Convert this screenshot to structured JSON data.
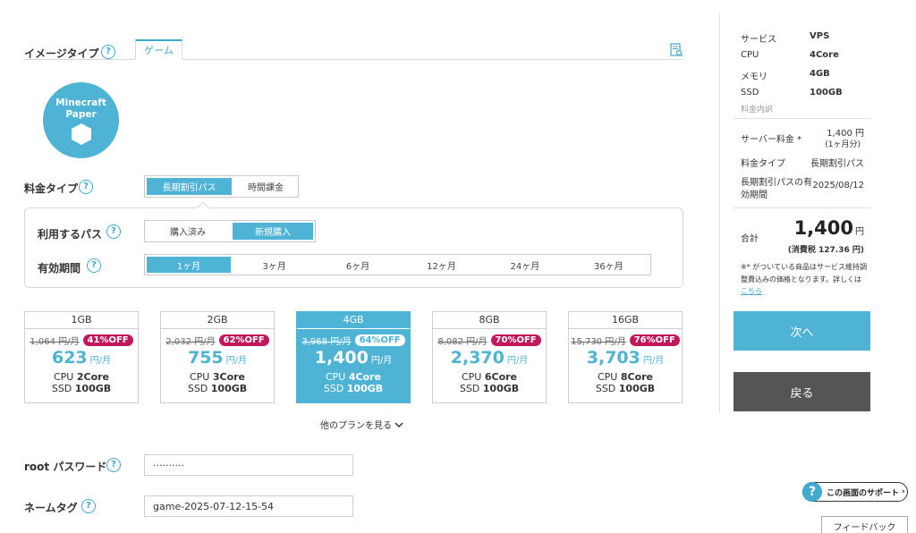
{
  "image_type": {
    "label": "イメージタイプ",
    "help": "?",
    "tab": "ゲーム",
    "doc_icon": "document-search-icon"
  },
  "logo": {
    "line1": "Minecraft",
    "line2": "Paper",
    "icon": "cube-icon"
  },
  "pricing_type": {
    "label": "料金タイプ",
    "help": "?",
    "options": [
      "長期割引パス",
      "時間課金"
    ],
    "selected": "長期割引パス"
  },
  "pass": {
    "label": "利用するパス",
    "help": "?",
    "options": [
      "購入済み",
      "新規購入"
    ],
    "selected": "新規購入"
  },
  "period": {
    "label": "有効期間",
    "help": "?",
    "options": [
      "1ヶ月",
      "3ヶ月",
      "6ヶ月",
      "12ヶ月",
      "24ヶ月",
      "36ヶ月"
    ],
    "selected": "1ヶ月"
  },
  "plans": [
    {
      "title": "1GB",
      "old": "1,064 円/月",
      "off": "41%OFF",
      "price": "623",
      "unit": "円/月",
      "cpu_prefix": "CPU ",
      "cpu": "2Core",
      "ssd_prefix": "SSD ",
      "ssd": "100GB",
      "selected": false
    },
    {
      "title": "2GB",
      "old": "2,032 円/月",
      "off": "62%OFF",
      "price": "755",
      "unit": "円/月",
      "cpu_prefix": "CPU ",
      "cpu": "3Core",
      "ssd_prefix": "SSD ",
      "ssd": "100GB",
      "selected": false
    },
    {
      "title": "4GB",
      "old": "3,968 円/月",
      "off": "64%OFF",
      "price": "1,400",
      "unit": "円/月",
      "cpu_prefix": "CPU ",
      "cpu": "4Core",
      "ssd_prefix": "SSD ",
      "ssd": "100GB",
      "selected": true
    },
    {
      "title": "8GB",
      "old": "8,082 円/月",
      "off": "70%OFF",
      "price": "2,370",
      "unit": "円/月",
      "cpu_prefix": "CPU ",
      "cpu": "6Core",
      "ssd_prefix": "SSD ",
      "ssd": "100GB",
      "selected": false
    },
    {
      "title": "16GB",
      "old": "15,730 円/月",
      "off": "76%OFF",
      "price": "3,703",
      "unit": "円/月",
      "cpu_prefix": "CPU ",
      "cpu": "8Core",
      "ssd_prefix": "SSD ",
      "ssd": "100GB",
      "selected": false
    }
  ],
  "more_plans": "他のプランを見る",
  "root_password": {
    "label": "root パスワード",
    "help": "?",
    "value": "··········"
  },
  "name_tag": {
    "label": "ネームタグ",
    "help": "?",
    "value": "game-2025-07-12-15-54"
  },
  "summary": {
    "rows": [
      {
        "key": "サービス",
        "val": "VPS"
      },
      {
        "key": "CPU",
        "val": "4Core"
      },
      {
        "key": "メモリ",
        "val": "4GB"
      },
      {
        "key": "SSD",
        "val": "100GB"
      }
    ],
    "breakdown_label": "料金内訳",
    "server_fee_label": "サーバー料金 *",
    "server_fee": "1,400 円",
    "server_fee_note": "(1ヶ月分)",
    "type_label": "料金タイプ",
    "type_val": "長期割引パス",
    "expiry_label_1": "長期割引パスの有",
    "expiry_label_2": "効期間",
    "expiry_val": "2025/08/12",
    "total_label": "合計",
    "total": "1,400",
    "total_unit": "円",
    "tax": "(消費税 127.36 円)",
    "note_1": "※* がついている商品はサービス維持調",
    "note_2": "整費込みの価格となります。詳しくは",
    "note_link": "こちら"
  },
  "buttons": {
    "next": "次へ",
    "back": "戻る"
  },
  "support": {
    "q": "?",
    "label": "この画面のサポート",
    "arrow": "›"
  },
  "feedback": "フィードバック",
  "colors": {
    "accent": "#4fb3d6",
    "discount": "#c2185b",
    "back_button": "#555555"
  }
}
